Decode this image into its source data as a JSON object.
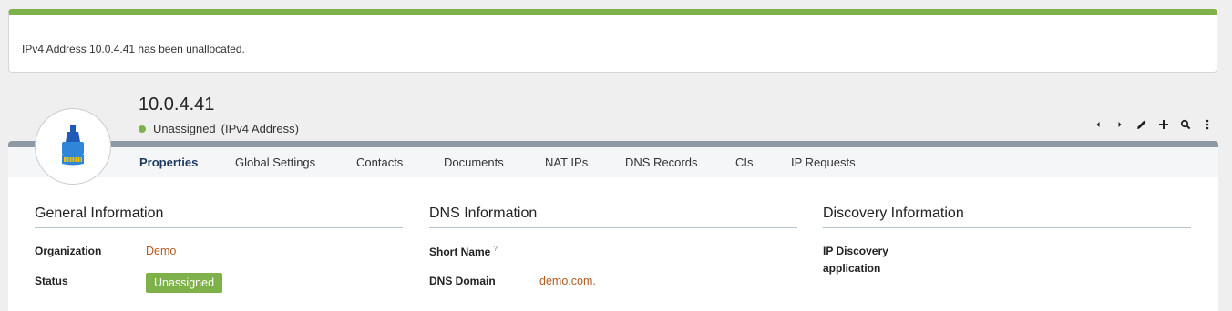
{
  "notification": {
    "message": "IPv4 Address 10.0.4.41 has been unallocated.",
    "accent_color": "#7eb14a"
  },
  "header": {
    "title": "10.0.4.41",
    "status": "Unassigned",
    "type": "(IPv4 Address)",
    "status_color": "#7eb14a",
    "icon": "network-port-icon"
  },
  "toolbar": {
    "icons": [
      "chevron-left-icon",
      "chevron-right-icon",
      "pencil-icon",
      "plus-icon",
      "search-icon",
      "more-vertical-icon"
    ]
  },
  "tabs": [
    {
      "label": "Properties",
      "active": true
    },
    {
      "label": "Global Settings",
      "active": false
    },
    {
      "label": "Contacts",
      "active": false
    },
    {
      "label": "Documents",
      "active": false
    },
    {
      "label": "NAT IPs",
      "active": false
    },
    {
      "label": "DNS Records",
      "active": false
    },
    {
      "label": "CIs",
      "active": false
    },
    {
      "label": "IP Requests",
      "active": false
    }
  ],
  "general": {
    "title": "General Information",
    "organization_label": "Organization",
    "organization_value": "Demo",
    "status_label": "Status",
    "status_value": "Unassigned"
  },
  "dns": {
    "title": "DNS Information",
    "short_name_label": "Short Name",
    "short_name_help": "?",
    "domain_label": "DNS Domain",
    "domain_value": "demo.com."
  },
  "discovery": {
    "title": "Discovery Information",
    "ip_discovery_label_line1": "IP Discovery",
    "ip_discovery_label_line2": "application"
  }
}
